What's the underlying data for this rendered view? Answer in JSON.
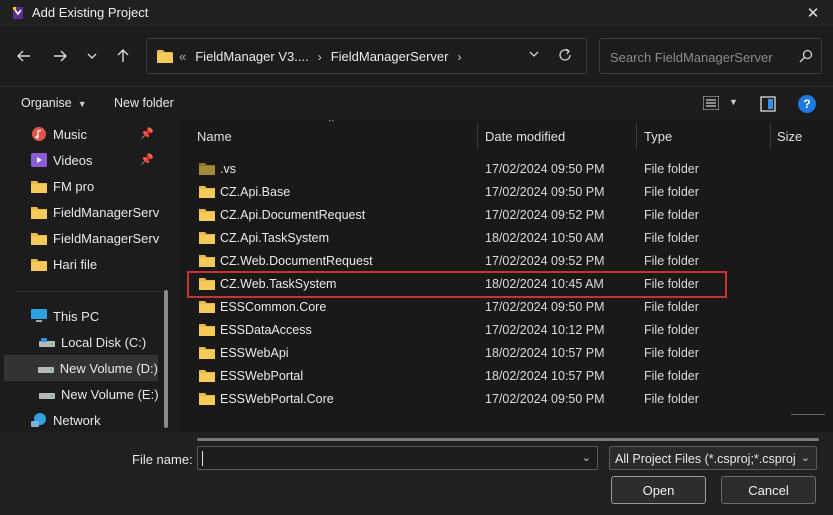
{
  "window": {
    "title": "Add Existing Project",
    "close_glyph": "✕"
  },
  "nav": {
    "back_glyph": "←",
    "forward_glyph": "→",
    "recent_glyph": "⌄",
    "up_glyph": "↑",
    "address": {
      "overflow": "«",
      "crumbs": [
        "FieldManager V3....",
        "FieldManagerServer"
      ]
    },
    "search_placeholder": "Search FieldManagerServer"
  },
  "toolbar": {
    "organise": "Organise",
    "new_folder": "New folder",
    "help": "?"
  },
  "sidebar": {
    "items": [
      {
        "label": "Music",
        "icon": "music-icon",
        "pinned": true
      },
      {
        "label": "Videos",
        "icon": "video-icon",
        "pinned": true
      },
      {
        "label": "FM pro",
        "icon": "folder-icon"
      },
      {
        "label": "FieldManagerServ",
        "icon": "folder-icon"
      },
      {
        "label": "FieldManagerServ",
        "icon": "folder-icon"
      },
      {
        "label": "Hari file",
        "icon": "folder-icon"
      },
      {
        "label": "This PC",
        "icon": "computer-icon"
      },
      {
        "label": "Local Disk (C:)",
        "icon": "drive-icon"
      },
      {
        "label": "New Volume (D:)",
        "icon": "drive-icon",
        "selected": true
      },
      {
        "label": "New Volume (E:)",
        "icon": "drive-icon"
      },
      {
        "label": "Network",
        "icon": "network-icon"
      }
    ]
  },
  "columns": {
    "name": "Name",
    "date": "Date modified",
    "type": "Type",
    "size": "Size"
  },
  "files": [
    {
      "name": ".vs",
      "date": "17/02/2024 09:50 PM",
      "type": "File folder",
      "dim": true
    },
    {
      "name": "CZ.Api.Base",
      "date": "17/02/2024 09:50 PM",
      "type": "File folder"
    },
    {
      "name": "CZ.Api.DocumentRequest",
      "date": "17/02/2024 09:52 PM",
      "type": "File folder"
    },
    {
      "name": "CZ.Api.TaskSystem",
      "date": "18/02/2024 10:50 AM",
      "type": "File folder"
    },
    {
      "name": "CZ.Web.DocumentRequest",
      "date": "17/02/2024 09:52 PM",
      "type": "File folder"
    },
    {
      "name": "CZ.Web.TaskSystem",
      "date": "18/02/2024 10:45 AM",
      "type": "File folder",
      "highlight": true
    },
    {
      "name": "ESSCommon.Core",
      "date": "17/02/2024 09:50 PM",
      "type": "File folder"
    },
    {
      "name": "ESSDataAccess",
      "date": "17/02/2024 10:12 PM",
      "type": "File folder"
    },
    {
      "name": "ESSWebApi",
      "date": "18/02/2024 10:57 PM",
      "type": "File folder"
    },
    {
      "name": "ESSWebPortal",
      "date": "18/02/2024 10:57 PM",
      "type": "File folder"
    },
    {
      "name": "ESSWebPortal.Core",
      "date": "17/02/2024 09:50 PM",
      "type": "File folder"
    }
  ],
  "bottom": {
    "file_name_label": "File name:",
    "file_name_value": "",
    "filter": "All Project Files (*.csproj;*.csproj",
    "open": "Open",
    "cancel": "Cancel"
  }
}
